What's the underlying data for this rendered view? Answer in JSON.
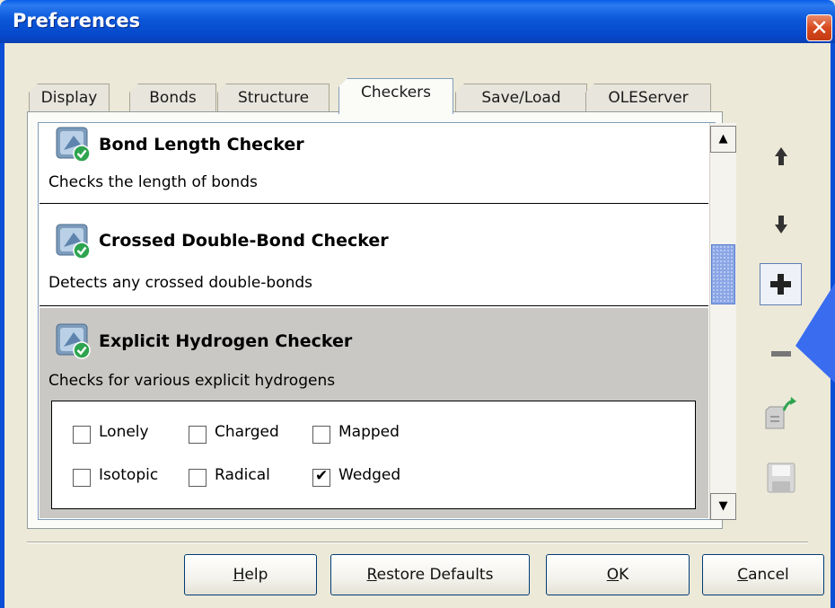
{
  "window": {
    "title": "Preferences",
    "close_symbol": "✕"
  },
  "tabs": [
    {
      "label": "Display",
      "active": false
    },
    {
      "label": "Bonds",
      "active": false
    },
    {
      "label": "Structure",
      "active": false
    },
    {
      "label": "Checkers",
      "active": true
    },
    {
      "label": "Save/Load",
      "active": false
    },
    {
      "label": "OLEServer",
      "active": false
    }
  ],
  "checkers": [
    {
      "title": "Bond Length Checker",
      "description": "Checks the length of bonds",
      "icon": "checker-icon",
      "selected": false
    },
    {
      "title": "Crossed Double-Bond Checker",
      "description": "Detects any crossed double-bonds",
      "icon": "checker-icon",
      "selected": false
    },
    {
      "title": "Explicit Hydrogen Checker",
      "description": "Checks for various explicit hydrogens",
      "icon": "checker-icon",
      "selected": true
    }
  ],
  "options": [
    {
      "label": "Lonely",
      "checked": false
    },
    {
      "label": "Charged",
      "checked": false
    },
    {
      "label": "Mapped",
      "checked": false
    },
    {
      "label": "Isotopic",
      "checked": false
    },
    {
      "label": "Radical",
      "checked": false
    },
    {
      "label": "Wedged",
      "checked": true
    }
  ],
  "check_mark": "✔",
  "scrollbar": {
    "up_symbol": "▲",
    "down_symbol": "▼",
    "position": 0.45
  },
  "toolbar": [
    {
      "name": "move-up-icon"
    },
    {
      "name": "move-down-icon"
    },
    {
      "name": "add-icon"
    },
    {
      "name": "remove-icon"
    },
    {
      "name": "export-icon"
    },
    {
      "name": "save-icon"
    }
  ],
  "buttons": {
    "help": {
      "mnemonic": "H",
      "rest": "elp"
    },
    "restore": {
      "mnemonic": "R",
      "rest": "estore Defaults"
    },
    "ok": {
      "mnemonic": "O",
      "rest": "K"
    },
    "cancel": {
      "mnemonic": "C",
      "rest": "ancel"
    }
  },
  "colors": {
    "titlebar": "#0a5ee8",
    "selected_item": "#c9c8c5",
    "accent_arrow": "#3a6cf0"
  }
}
